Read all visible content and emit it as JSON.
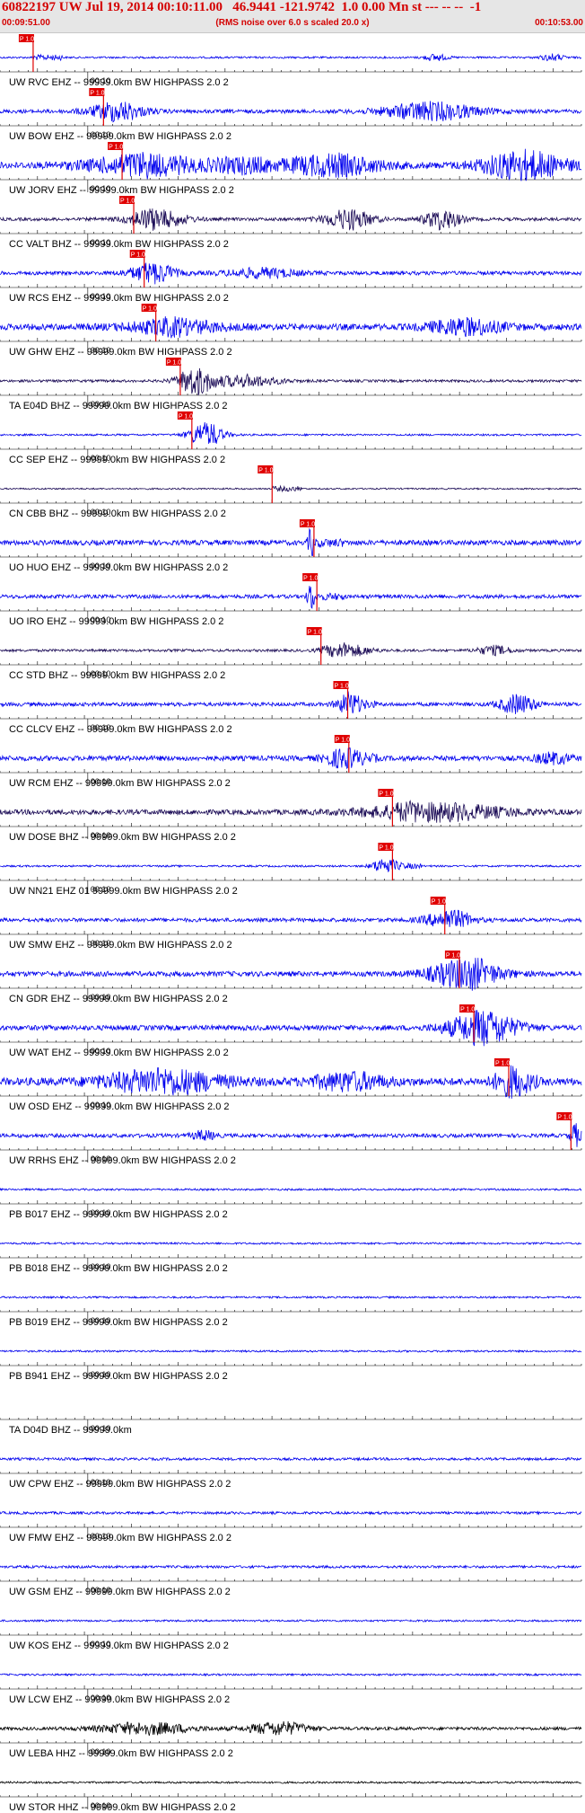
{
  "header": {
    "title": "60822197 UW Jul 19, 2014 00:10:11.00   46.9441 -121.9742  1.0 0.00 Mn st --- -- --  -1",
    "start_time": "00:09:51.00",
    "end_time": "00:10:53.00",
    "note": "(RMS noise over 6.0 s scaled 20.0 x)"
  },
  "colors": {
    "header_text": "#d40000",
    "trace_blue": "#0000ee",
    "trace_dark": "#1a0a55",
    "trace_black": "#000000",
    "pick_red": "#e00000",
    "header_bg": "#e6e6e6"
  },
  "chart_data": {
    "type": "line",
    "x_axis": {
      "start": "00:09:51.00",
      "end": "00:10:53.00",
      "tick_label": "00:10"
    },
    "pick_label": "P 1.0",
    "series": [
      {
        "name": "UW RVC EHZ -- 99999.0km BW  HIGHPASS  2.0  2",
        "pick": 0.057,
        "color": "blue",
        "amp": 0.15,
        "bursts": [
          [
            0.75,
            0.02,
            0.5
          ],
          [
            0.95,
            0.02,
            0.5
          ]
        ]
      },
      {
        "name": "UW BOW EHZ -- 99999.0km BW  HIGHPASS  2.0  2",
        "pick": 0.178,
        "color": "blue",
        "amp": 0.3,
        "bursts": [
          [
            0.2,
            0.05,
            1.2
          ],
          [
            0.74,
            0.08,
            1.4
          ]
        ]
      },
      {
        "name": "UW JORV EHZ -- 99999.0km BW  HIGHPASS  2.0  2",
        "pick": 0.21,
        "color": "blue",
        "amp": 0.5,
        "bursts": [
          [
            0.25,
            0.1,
            1.5
          ],
          [
            0.57,
            0.08,
            1.6
          ],
          [
            0.9,
            0.07,
            2.2
          ],
          [
            0.42,
            0.05,
            1.0
          ]
        ]
      },
      {
        "name": "CC VALT BHZ -- 99999.0km BW  HIGHPASS  2.0  2",
        "pick": 0.23,
        "color": "dark",
        "amp": 0.25,
        "bursts": [
          [
            0.27,
            0.05,
            1.4
          ],
          [
            0.6,
            0.04,
            1.6
          ],
          [
            0.76,
            0.03,
            1.6
          ]
        ]
      },
      {
        "name": "UW RCS EHZ -- 99999.0km BW  HIGHPASS  2.0  2",
        "pick": 0.248,
        "color": "blue",
        "amp": 0.3,
        "bursts": [
          [
            0.26,
            0.04,
            1.3
          ],
          [
            0.45,
            0.06,
            0.7
          ]
        ]
      },
      {
        "name": "UW GHW EHZ -- 99999.0km BW  HIGHPASS  2.0  2",
        "pick": 0.268,
        "color": "blue",
        "amp": 0.5,
        "bursts": [
          [
            0.3,
            0.08,
            1.0
          ],
          [
            0.8,
            0.06,
            1.2
          ]
        ]
      },
      {
        "name": "TA E04D BHZ -- 99999.0km BW  HIGHPASS  2.0  2",
        "pick": 0.31,
        "color": "dark",
        "amp": 0.2,
        "bursts": [
          [
            0.335,
            0.03,
            1.8
          ],
          [
            0.42,
            0.06,
            0.9
          ]
        ]
      },
      {
        "name": "CC SEP EHZ -- 99999.0km BW  HIGHPASS  2.0  2",
        "pick": 0.33,
        "color": "blue",
        "amp": 0.15,
        "bursts": [
          [
            0.355,
            0.03,
            1.6
          ]
        ]
      },
      {
        "name": "CN CBB BHZ -- 99999.0km BW  HIGHPASS  2.0  2",
        "pick": 0.468,
        "color": "dark",
        "amp": 0.12,
        "bursts": []
      },
      {
        "name": "UO HUO EHZ -- 99999.0km BW  HIGHPASS  2.0  2",
        "pick": 0.54,
        "color": "blue",
        "amp": 0.4,
        "bursts": [
          [
            0.535,
            0.005,
            2.4
          ]
        ]
      },
      {
        "name": "UO IRO EHZ -- 99999.0km BW  HIGHPASS  2.0  2",
        "pick": 0.545,
        "color": "blue",
        "amp": 0.3,
        "bursts": [
          [
            0.535,
            0.006,
            2.4
          ]
        ]
      },
      {
        "name": "CC STD BHZ -- 99999.0km BW  HIGHPASS  2.0  2",
        "pick": 0.552,
        "color": "dark",
        "amp": 0.2,
        "bursts": [
          [
            0.6,
            0.04,
            0.9
          ],
          [
            0.85,
            0.03,
            0.7
          ]
        ]
      },
      {
        "name": "CC CLCV EHZ -- 99999.0km BW  HIGHPASS  2.0  2",
        "pick": 0.598,
        "color": "blue",
        "amp": 0.3,
        "bursts": [
          [
            0.6,
            0.02,
            1.6
          ],
          [
            0.89,
            0.03,
            1.5
          ]
        ]
      },
      {
        "name": "UW RCM EHZ -- 99999.0km BW  HIGHPASS  2.0  2",
        "pick": 0.6,
        "color": "blue",
        "amp": 0.4,
        "bursts": [
          [
            0.59,
            0.03,
            1.4
          ],
          [
            0.95,
            0.03,
            0.8
          ]
        ]
      },
      {
        "name": "UW DOSE BHZ -- 99999.0km BW  HIGHPASS  2.0  2",
        "pick": 0.675,
        "color": "dark",
        "amp": 0.4,
        "bursts": [
          [
            0.75,
            0.12,
            1.3
          ]
        ]
      },
      {
        "name": "UW NN21 EHZ 01 99999.0km BW  HIGHPASS  2.0  2",
        "pick": 0.675,
        "color": "blue",
        "amp": 0.15,
        "bursts": [
          [
            0.66,
            0.02,
            1.2
          ]
        ]
      },
      {
        "name": "UW SMW EHZ -- 99999.0km BW  HIGHPASS  2.0  2",
        "pick": 0.765,
        "color": "blue",
        "amp": 0.3,
        "bursts": [
          [
            0.77,
            0.04,
            1.2
          ]
        ]
      },
      {
        "name": "CN GDR EHZ -- 99999.0km BW  HIGHPASS  2.0  2",
        "pick": 0.79,
        "color": "blue",
        "amp": 0.4,
        "bursts": [
          [
            0.8,
            0.06,
            2.2
          ]
        ]
      },
      {
        "name": "UW WAT EHZ -- 99999.0km BW  HIGHPASS  2.0  2",
        "pick": 0.815,
        "color": "blue",
        "amp": 0.4,
        "bursts": [
          [
            0.83,
            0.06,
            2.4
          ]
        ]
      },
      {
        "name": "UW OSD EHZ -- 99999.0km BW  HIGHPASS  2.0  2",
        "pick": 0.875,
        "color": "blue",
        "amp": 0.6,
        "bursts": [
          [
            0.28,
            0.1,
            1.8
          ],
          [
            0.6,
            0.06,
            1.3
          ],
          [
            0.88,
            0.03,
            2.0
          ]
        ]
      },
      {
        "name": "UW RRHS EHZ -- 99999.0km BW  HIGHPASS  2.0  2",
        "pick": 0.982,
        "color": "blue",
        "amp": 0.3,
        "bursts": [
          [
            0.35,
            0.02,
            0.7
          ],
          [
            0.99,
            0.01,
            1.4
          ]
        ]
      },
      {
        "name": "PB B017 EHZ -- 99999.0km BW  HIGHPASS  2.0  2",
        "pick": null,
        "color": "blue",
        "amp": 0.15,
        "bursts": []
      },
      {
        "name": "PB B018 EHZ -- 99999.0km BW  HIGHPASS  2.0  2",
        "pick": null,
        "color": "blue",
        "amp": 0.15,
        "bursts": []
      },
      {
        "name": "PB B019 EHZ -- 99999.0km BW  HIGHPASS  2.0  2",
        "pick": null,
        "color": "blue",
        "amp": 0.15,
        "bursts": []
      },
      {
        "name": "PB B941 EHZ -- 99999.0km BW  HIGHPASS  2.0  2",
        "pick": null,
        "color": "blue",
        "amp": 0.15,
        "bursts": []
      },
      {
        "name": "TA D04D BHZ -- 99999.0km",
        "pick": null,
        "color": "none",
        "amp": 0,
        "bursts": []
      },
      {
        "name": "UW CPW EHZ -- 99999.0km BW  HIGHPASS  2.0  2",
        "pick": null,
        "color": "blue",
        "amp": 0.2,
        "bursts": []
      },
      {
        "name": "UW FMW EHZ -- 99999.0km BW  HIGHPASS  2.0  2",
        "pick": null,
        "color": "blue",
        "amp": 0.2,
        "bursts": []
      },
      {
        "name": "UW GSM EHZ -- 99999.0km BW  HIGHPASS  2.0  2",
        "pick": null,
        "color": "blue",
        "amp": 0.2,
        "bursts": []
      },
      {
        "name": "UW KOS EHZ -- 99999.0km BW  HIGHPASS  2.0  2",
        "pick": null,
        "color": "blue",
        "amp": 0.15,
        "bursts": []
      },
      {
        "name": "UW LCW EHZ -- 99999.0km BW  HIGHPASS  2.0  2",
        "pick": null,
        "color": "blue",
        "amp": 0.15,
        "bursts": []
      },
      {
        "name": "UW LEBA HHZ -- 99999.0km BW  HIGHPASS  2.0  2",
        "pick": null,
        "color": "black",
        "amp": 0.25,
        "bursts": [
          [
            0.25,
            0.08,
            0.9
          ],
          [
            0.48,
            0.05,
            1.0
          ]
        ]
      },
      {
        "name": "UW STOR HHZ -- 99999.0km BW  HIGHPASS  2.0  2",
        "pick": null,
        "color": "black",
        "amp": 0.15,
        "bursts": []
      }
    ]
  }
}
